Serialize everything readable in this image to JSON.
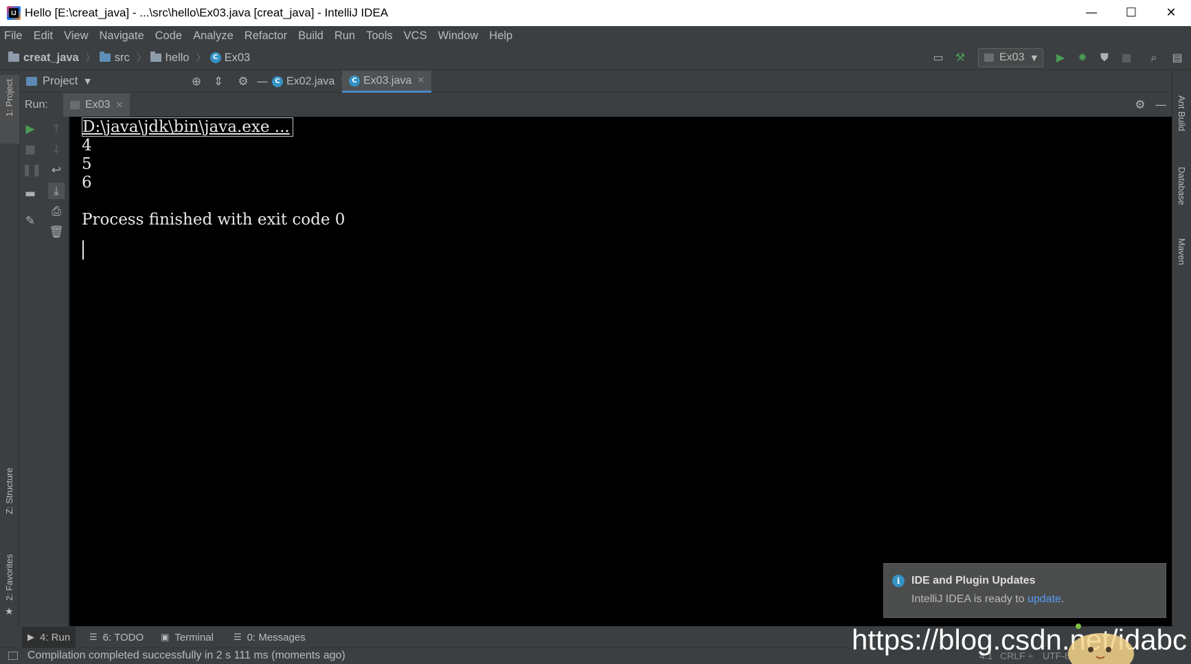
{
  "window": {
    "title": "Hello [E:\\creat_java] - ...\\src\\hello\\Ex03.java [creat_java] - IntelliJ IDEA",
    "minimize": "—",
    "maximize": "☐",
    "close": "✕"
  },
  "menu": [
    "File",
    "Edit",
    "View",
    "Navigate",
    "Code",
    "Analyze",
    "Refactor",
    "Build",
    "Run",
    "Tools",
    "VCS",
    "Window",
    "Help"
  ],
  "breadcrumb": {
    "project": "creat_java",
    "src": "src",
    "package": "hello",
    "class": "Ex03"
  },
  "toolbar": {
    "run_config": "Ex03",
    "icons": [
      "project-structure-icon",
      "build-hammer-icon",
      "run-icon",
      "debug-icon",
      "coverage-icon",
      "stop-icon",
      "search-icon",
      "folder-settings-icon"
    ]
  },
  "project_panel": {
    "label": "Project"
  },
  "editor_tabs": [
    {
      "label": "Ex02.java",
      "active": false
    },
    {
      "label": "Ex03.java",
      "active": true
    }
  ],
  "run": {
    "label": "Run:",
    "tab": "Ex03"
  },
  "console": {
    "command": "D:\\java\\jdk\\bin\\java.exe ...",
    "lines": [
      "4",
      "5",
      "6",
      "",
      "Process finished with exit code 0"
    ]
  },
  "left_stripe": {
    "project": "1: Project",
    "structure": "Z: Structure",
    "favorites": "2: Favorites"
  },
  "right_stripe": {
    "ant": "Ant Build",
    "database": "Database",
    "maven": "Maven"
  },
  "notification": {
    "title": "IDE and Plugin Updates",
    "body": "IntelliJ IDEA is ready to ",
    "link": "update",
    "suffix": "."
  },
  "bottom_tabs": [
    {
      "label": "4: Run",
      "active": true
    },
    {
      "label": "6: TODO",
      "active": false
    },
    {
      "label": "Terminal",
      "active": false
    },
    {
      "label": "0: Messages",
      "active": false
    }
  ],
  "status": {
    "message": "Compilation completed successfully in 2 s 111 ms (moments ago)",
    "position": "4:1",
    "line_sep": "CRLF ÷",
    "encoding": "UTF-8"
  },
  "watermark": "https://blog.csdn.net/idabc",
  "colors": {
    "background": "#3c3f41",
    "console_bg": "#000000",
    "accent": "#4a88c7",
    "run_green": "#499c54",
    "link": "#589df6"
  }
}
